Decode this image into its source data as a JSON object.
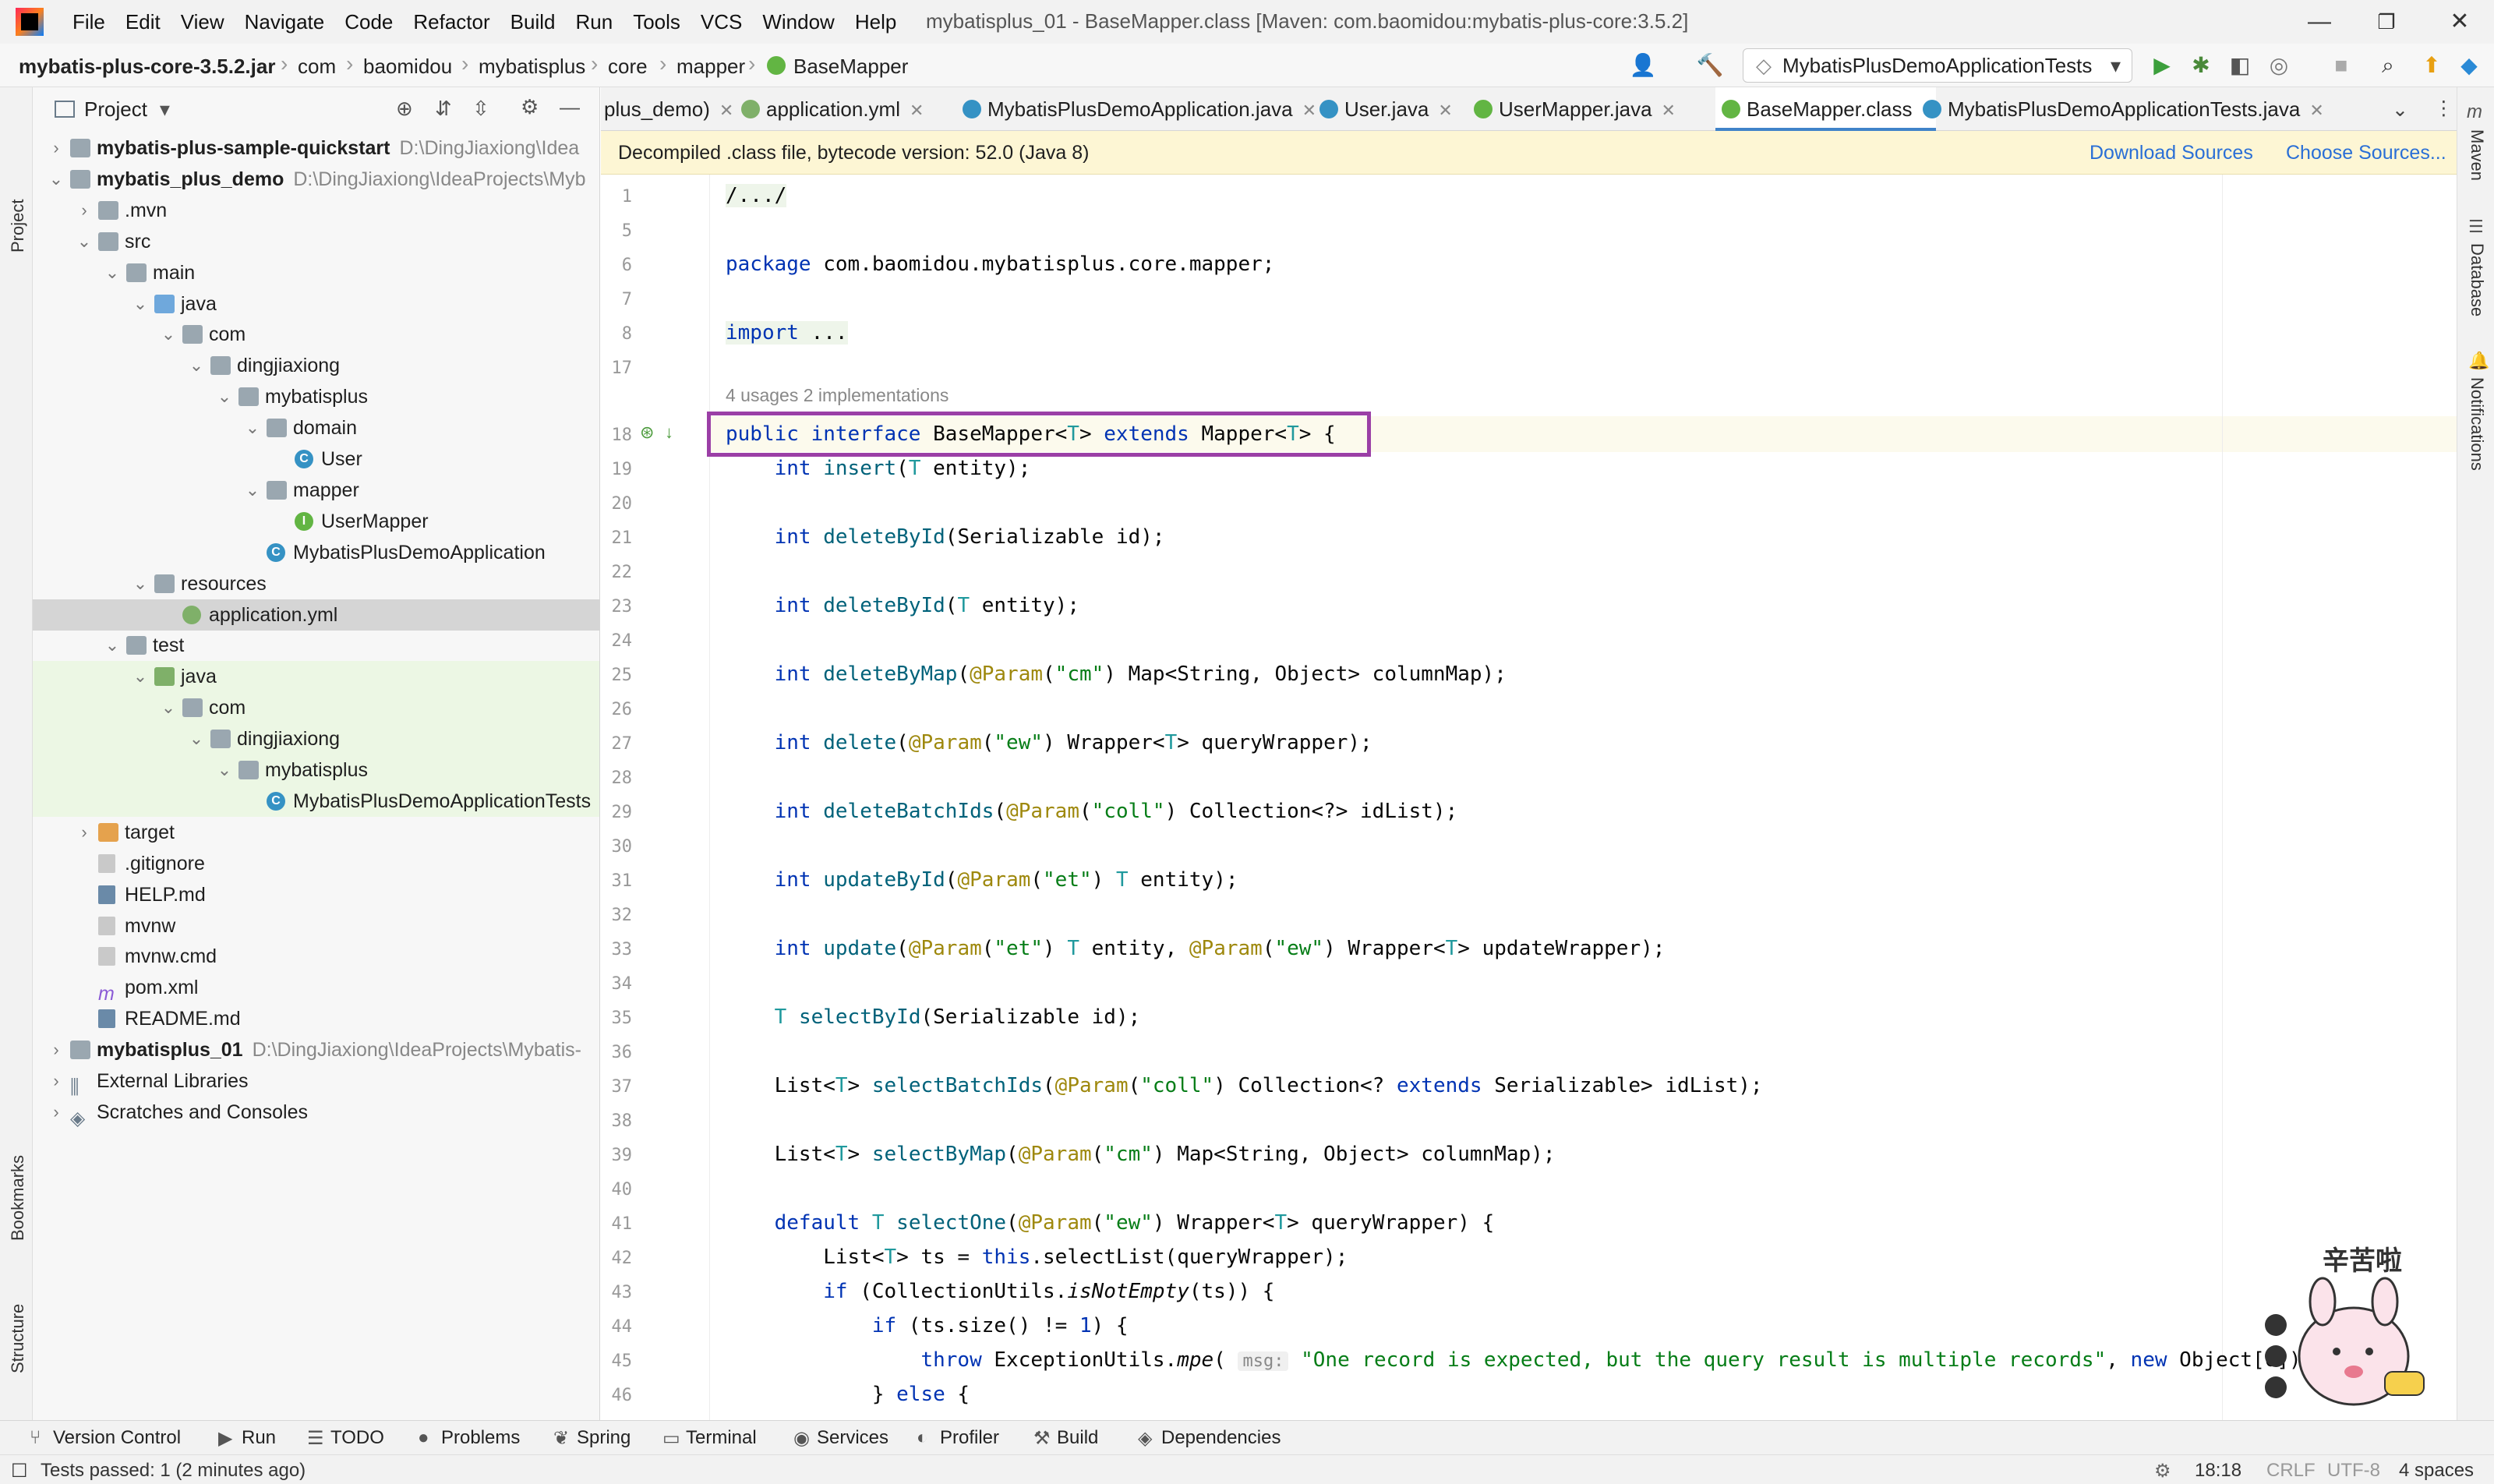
{
  "menu": [
    "File",
    "Edit",
    "View",
    "Navigate",
    "Code",
    "Refactor",
    "Build",
    "Run",
    "Tools",
    "VCS",
    "Window",
    "Help"
  ],
  "window_title": "mybatisplus_01 - BaseMapper.class [Maven: com.baomidou:mybatis-plus-core:3.5.2]",
  "window_controls": {
    "minimize": "—",
    "restore": "❐",
    "close": "✕"
  },
  "breadcrumb": [
    "mybatis-plus-core-3.5.2.jar",
    "com",
    "baomidou",
    "mybatisplus",
    "core",
    "mapper",
    "BaseMapper"
  ],
  "run_config": "MybatisPlusDemoApplicationTests",
  "left_strip": {
    "project": "Project",
    "bookmarks": "Bookmarks",
    "structure": "Structure"
  },
  "right_strip": {
    "maven": "Maven",
    "database": "Database",
    "notifications": "Notifications"
  },
  "project_panel": {
    "title": "Project",
    "tree": [
      {
        "label": "mybatis-plus-sample-quickstart",
        "path": "D:\\DingJiaxiong\\Idea",
        "depth": 0,
        "bold": true,
        "chev": "right",
        "icon": "module"
      },
      {
        "label": "mybatis_plus_demo",
        "path": "D:\\DingJiaxiong\\IdeaProjects\\Myb",
        "depth": 0,
        "bold": true,
        "chev": "down",
        "icon": "module"
      },
      {
        "label": ".mvn",
        "path": "",
        "depth": 1,
        "chev": "right",
        "icon": "folder"
      },
      {
        "label": "src",
        "path": "",
        "depth": 1,
        "chev": "down",
        "icon": "folder"
      },
      {
        "label": "main",
        "path": "",
        "depth": 2,
        "chev": "down",
        "icon": "folder"
      },
      {
        "label": "java",
        "path": "",
        "depth": 3,
        "chev": "down",
        "icon": "folder-blue"
      },
      {
        "label": "com",
        "path": "",
        "depth": 4,
        "chev": "down",
        "icon": "folder"
      },
      {
        "label": "dingjiaxiong",
        "path": "",
        "depth": 5,
        "chev": "down",
        "icon": "folder"
      },
      {
        "label": "mybatisplus",
        "path": "",
        "depth": 6,
        "chev": "down",
        "icon": "folder"
      },
      {
        "label": "domain",
        "path": "",
        "depth": 7,
        "chev": "down",
        "icon": "folder"
      },
      {
        "label": "User",
        "path": "",
        "depth": 8,
        "chev": "",
        "icon": "class"
      },
      {
        "label": "mapper",
        "path": "",
        "depth": 7,
        "chev": "down",
        "icon": "folder"
      },
      {
        "label": "UserMapper",
        "path": "",
        "depth": 8,
        "chev": "",
        "icon": "interface"
      },
      {
        "label": "MybatisPlusDemoApplication",
        "path": "",
        "depth": 7,
        "chev": "",
        "icon": "class"
      },
      {
        "label": "resources",
        "path": "",
        "depth": 3,
        "chev": "down",
        "icon": "folder-res"
      },
      {
        "label": "application.yml",
        "path": "",
        "depth": 4,
        "chev": "",
        "icon": "yml",
        "selected": true
      },
      {
        "label": "test",
        "path": "",
        "depth": 2,
        "chev": "down",
        "icon": "folder"
      },
      {
        "label": "java",
        "path": "",
        "depth": 3,
        "chev": "down",
        "icon": "folder-green",
        "test": true
      },
      {
        "label": "com",
        "path": "",
        "depth": 4,
        "chev": "down",
        "icon": "folder",
        "test": true
      },
      {
        "label": "dingjiaxiong",
        "path": "",
        "depth": 5,
        "chev": "down",
        "icon": "folder",
        "test": true
      },
      {
        "label": "mybatisplus",
        "path": "",
        "depth": 6,
        "chev": "down",
        "icon": "folder",
        "test": true
      },
      {
        "label": "MybatisPlusDemoApplicationTests",
        "path": "",
        "depth": 7,
        "chev": "",
        "icon": "class",
        "test": true
      },
      {
        "label": "target",
        "path": "",
        "depth": 1,
        "chev": "right",
        "icon": "folder-orange"
      },
      {
        "label": ".gitignore",
        "path": "",
        "depth": 1,
        "chev": "",
        "icon": "file"
      },
      {
        "label": "HELP.md",
        "path": "",
        "depth": 1,
        "chev": "",
        "icon": "md"
      },
      {
        "label": "mvnw",
        "path": "",
        "depth": 1,
        "chev": "",
        "icon": "file"
      },
      {
        "label": "mvnw.cmd",
        "path": "",
        "depth": 1,
        "chev": "",
        "icon": "file"
      },
      {
        "label": "pom.xml",
        "path": "",
        "depth": 1,
        "chev": "",
        "icon": "maven"
      },
      {
        "label": "README.md",
        "path": "",
        "depth": 1,
        "chev": "",
        "icon": "md"
      },
      {
        "label": "mybatisplus_01",
        "path": "D:\\DingJiaxiong\\IdeaProjects\\Mybatis-",
        "depth": 0,
        "bold": true,
        "chev": "right",
        "icon": "module"
      },
      {
        "label": "External Libraries",
        "path": "",
        "depth": 0,
        "chev": "right",
        "icon": "libs"
      },
      {
        "label": "Scratches and Consoles",
        "path": "",
        "depth": 0,
        "chev": "right",
        "icon": "scratch"
      }
    ]
  },
  "tabs": [
    {
      "label": "plus_demo)",
      "icon": "",
      "active": false
    },
    {
      "label": "application.yml",
      "icon": "yml",
      "active": false
    },
    {
      "label": "MybatisPlusDemoApplication.java",
      "icon": "class",
      "active": false
    },
    {
      "label": "User.java",
      "icon": "class",
      "active": false
    },
    {
      "label": "UserMapper.java",
      "icon": "interface",
      "active": false
    },
    {
      "label": "BaseMapper.class",
      "icon": "interface",
      "active": true
    },
    {
      "label": "MybatisPlusDemoApplicationTests.java",
      "icon": "class",
      "active": false
    }
  ],
  "banner": {
    "text": "Decompiled .class file, bytecode version: 52.0 (Java 8)",
    "download_sources": "Download Sources",
    "choose_sources": "Choose Sources..."
  },
  "code": {
    "usages": "4 usages   2 implementations",
    "lines": [
      {
        "n": "1",
        "html": "/.../"
      },
      {
        "n": "5",
        "html": ""
      },
      {
        "n": "6",
        "html": "<span class=\"kw\">package</span> com.baomidou.mybatisplus.core.mapper;"
      },
      {
        "n": "7",
        "html": ""
      },
      {
        "n": "8",
        "html": "<span class=\"kw\">import</span> ..."
      },
      {
        "n": "17",
        "html": ""
      },
      {
        "n": "18",
        "html": "<span class=\"kw\">public interface</span> BaseMapper&lt;<span class=\"tp\">T</span>&gt; <span class=\"kw\">extends</span> Mapper&lt;<span class=\"tp\">T</span>&gt; {"
      },
      {
        "n": "19",
        "html": "    <span class=\"kw\">int</span> <span class=\"fn\">insert</span>(<span class=\"tp\">T</span> entity);"
      },
      {
        "n": "20",
        "html": ""
      },
      {
        "n": "21",
        "html": "    <span class=\"kw\">int</span> <span class=\"fn\">deleteById</span>(Serializable id);"
      },
      {
        "n": "22",
        "html": ""
      },
      {
        "n": "23",
        "html": "    <span class=\"kw\">int</span> <span class=\"fn\">deleteById</span>(<span class=\"tp\">T</span> entity);"
      },
      {
        "n": "24",
        "html": ""
      },
      {
        "n": "25",
        "html": "    <span class=\"kw\">int</span> <span class=\"fn\">deleteByMap</span>(<span class=\"ann\">@Param</span>(<span class=\"str\">\"cm\"</span>) Map&lt;String, Object&gt; columnMap);"
      },
      {
        "n": "26",
        "html": ""
      },
      {
        "n": "27",
        "html": "    <span class=\"kw\">int</span> <span class=\"fn\">delete</span>(<span class=\"ann\">@Param</span>(<span class=\"str\">\"ew\"</span>) Wrapper&lt;<span class=\"tp\">T</span>&gt; queryWrapper);"
      },
      {
        "n": "28",
        "html": ""
      },
      {
        "n": "29",
        "html": "    <span class=\"kw\">int</span> <span class=\"fn\">deleteBatchIds</span>(<span class=\"ann\">@Param</span>(<span class=\"str\">\"coll\"</span>) Collection&lt;?&gt; idList);"
      },
      {
        "n": "30",
        "html": ""
      },
      {
        "n": "31",
        "html": "    <span class=\"kw\">int</span> <span class=\"fn\">updateById</span>(<span class=\"ann\">@Param</span>(<span class=\"str\">\"et\"</span>) <span class=\"tp\">T</span> entity);"
      },
      {
        "n": "32",
        "html": ""
      },
      {
        "n": "33",
        "html": "    <span class=\"kw\">int</span> <span class=\"fn\">update</span>(<span class=\"ann\">@Param</span>(<span class=\"str\">\"et\"</span>) <span class=\"tp\">T</span> entity, <span class=\"ann\">@Param</span>(<span class=\"str\">\"ew\"</span>) Wrapper&lt;<span class=\"tp\">T</span>&gt; updateWrapper);"
      },
      {
        "n": "34",
        "html": ""
      },
      {
        "n": "35",
        "html": "    <span class=\"tp\">T</span> <span class=\"fn\">selectById</span>(Serializable id);"
      },
      {
        "n": "36",
        "html": ""
      },
      {
        "n": "37",
        "html": "    List&lt;<span class=\"tp\">T</span>&gt; <span class=\"fn\">selectBatchIds</span>(<span class=\"ann\">@Param</span>(<span class=\"str\">\"coll\"</span>) Collection&lt;? <span class=\"kw\">extends</span> Serializable&gt; idList);"
      },
      {
        "n": "38",
        "html": ""
      },
      {
        "n": "39",
        "html": "    List&lt;<span class=\"tp\">T</span>&gt; <span class=\"fn\">selectByMap</span>(<span class=\"ann\">@Param</span>(<span class=\"str\">\"cm\"</span>) Map&lt;String, Object&gt; columnMap);"
      },
      {
        "n": "40",
        "html": ""
      },
      {
        "n": "41",
        "html": "    <span class=\"kw\">default</span> <span class=\"tp\">T</span> <span class=\"fn\">selectOne</span>(<span class=\"ann\">@Param</span>(<span class=\"str\">\"ew\"</span>) Wrapper&lt;<span class=\"tp\">T</span>&gt; queryWrapper) {"
      },
      {
        "n": "42",
        "html": "        List&lt;<span class=\"tp\">T</span>&gt; ts = <span class=\"kw\">this</span>.selectList(queryWrapper);"
      },
      {
        "n": "43",
        "html": "        <span class=\"kw\">if</span> (CollectionUtils.<span class=\"it\">isNotEmpty</span>(ts)) {"
      },
      {
        "n": "44",
        "html": "            <span class=\"kw\">if</span> (ts.size() != <span class=\"kw\">1</span>) {"
      },
      {
        "n": "45",
        "html": "                <span class=\"kw\">throw</span> ExceptionUtils.<span class=\"it\">mpe</span>( <span class=\"hint\">msg:</span> <span class=\"str\">\"One record is expected, but the query result is multiple records\"</span>, <span class=\"kw\">new</span> Object[0]);"
      },
      {
        "n": "46",
        "html": "            } <span class=\"kw\">else</span> {"
      }
    ]
  },
  "bottom_tools": [
    "Version Control",
    "Run",
    "TODO",
    "Problems",
    "Spring",
    "Terminal",
    "Services",
    "Profiler",
    "Build",
    "Dependencies"
  ],
  "status": {
    "left": "Tests passed: 1 (2 minutes ago)",
    "time": "18:18",
    "line_sep": "CRLF",
    "encoding": "UTF-8",
    "indent": "4 spaces"
  },
  "sticker_text": "辛苦啦",
  "colors": {
    "highlight_box": "#9b3fa6",
    "banner_bg": "#fdf6d4",
    "link": "#2a6fd6",
    "active_tab": "#4083c9"
  }
}
